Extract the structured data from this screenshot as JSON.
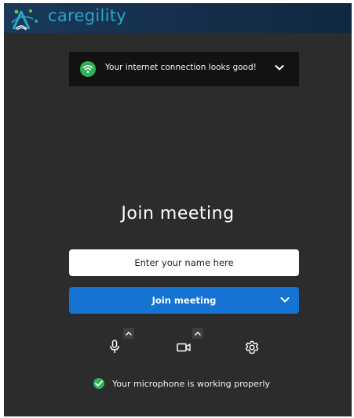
{
  "brand": {
    "name": "caregility",
    "color": "#2aa7c6",
    "icon": "caregility-logo-icon"
  },
  "connection_banner": {
    "text": "Your internet connection looks good!",
    "icon": "wifi-icon",
    "status_color": "#2fb356"
  },
  "join": {
    "title": "Join meeting",
    "name_placeholder": "Enter your name here",
    "name_value": "",
    "button_label": "Join meeting",
    "button_color": "#1473d3"
  },
  "controls": [
    {
      "name": "microphone",
      "icon": "microphone-icon"
    },
    {
      "name": "camera",
      "icon": "camera-icon"
    },
    {
      "name": "settings",
      "icon": "gear-icon"
    }
  ],
  "mic_status": {
    "text": "Your microphone is working properly",
    "icon": "check-circle-icon",
    "color": "#2fb356"
  }
}
